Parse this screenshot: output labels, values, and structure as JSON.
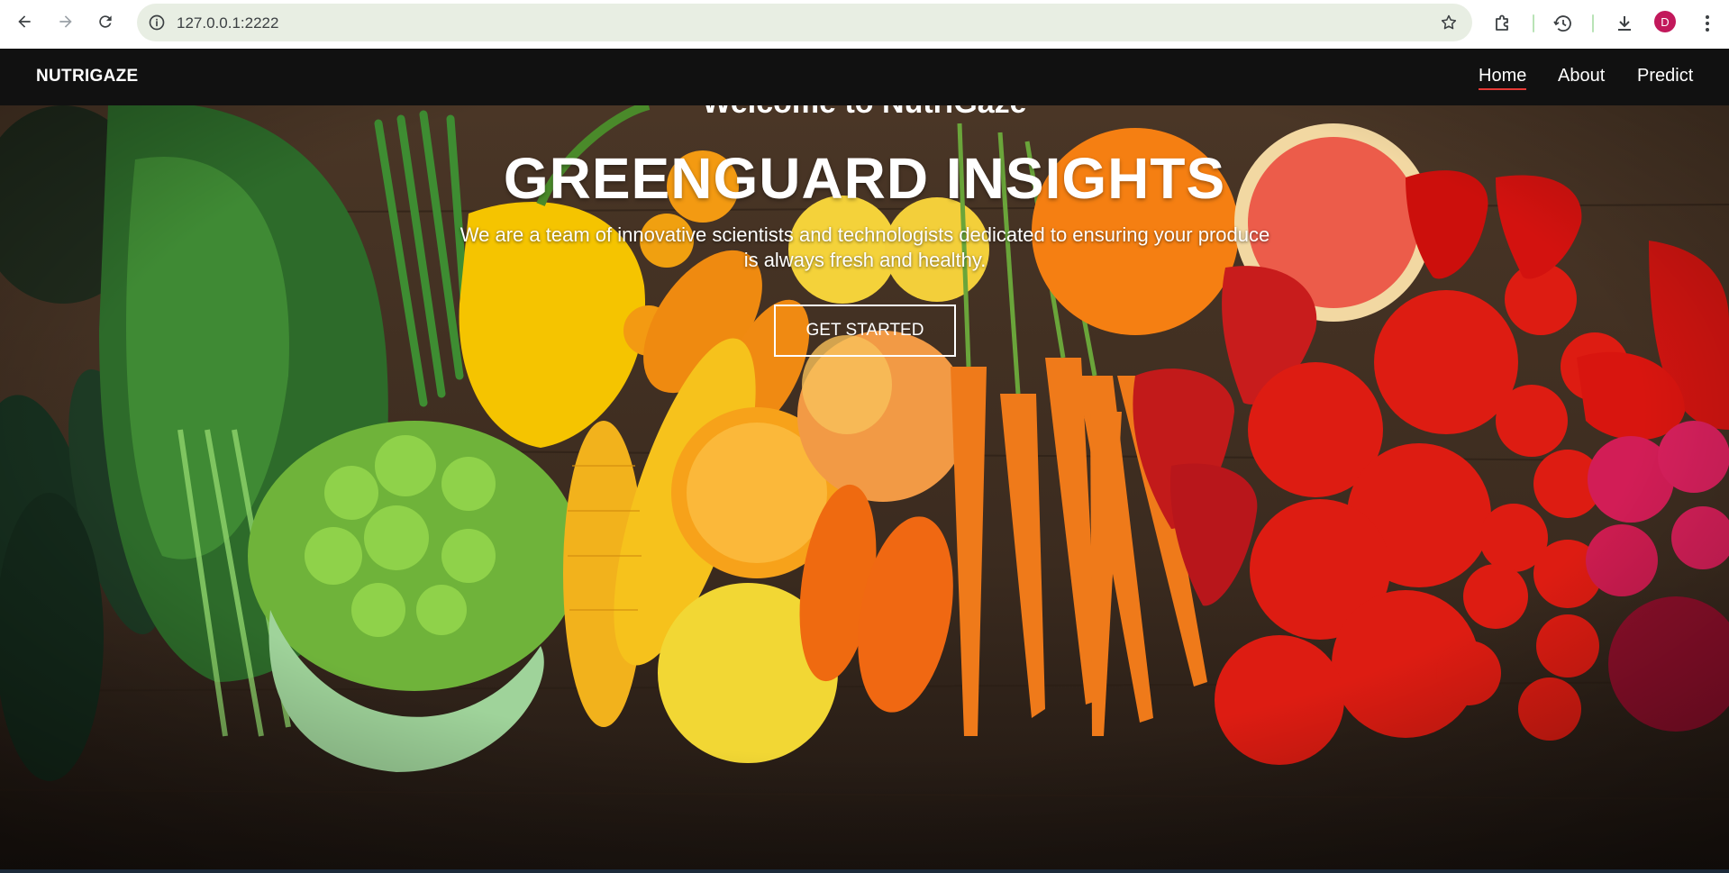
{
  "browser": {
    "url": "127.0.0.1:2222",
    "avatar_letter": "D",
    "icons": [
      "back-icon",
      "forward-icon",
      "reload-icon",
      "site-info-icon",
      "bookmark-star-icon",
      "extensions-icon",
      "history-icon",
      "download-icon",
      "menu-icon"
    ]
  },
  "navbar": {
    "brand": "NUTRIGAZE",
    "links": [
      {
        "label": "Home",
        "active": true
      },
      {
        "label": "About",
        "active": false
      },
      {
        "label": "Predict",
        "active": false
      }
    ],
    "active_underline_color": "#e53935"
  },
  "hero": {
    "welcome_text": "Welcome to NutriGaze",
    "title": "GREENGUARD INSIGHTS",
    "subtitle_line1": "We are a team of innovative scientists and technologists dedicated to ensuring your produce",
    "subtitle_line2": "is always fresh and healthy.",
    "cta_label": "GET STARTED"
  }
}
